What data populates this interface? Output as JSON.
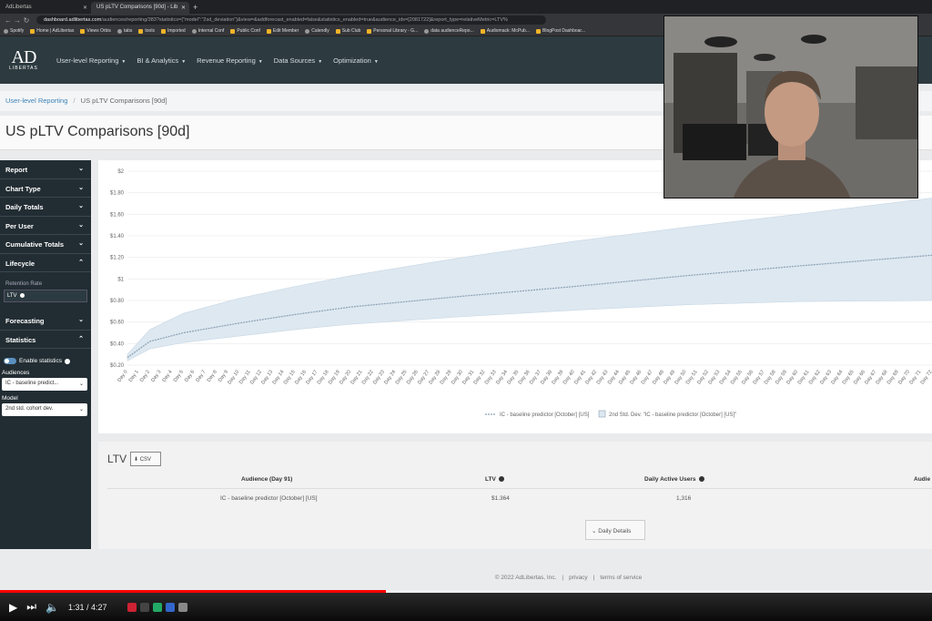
{
  "browser": {
    "tabs": [
      {
        "label": "AdLibertas",
        "active": false
      },
      {
        "label": "US pLTV Comparisons [90d] - Lib",
        "active": true
      }
    ],
    "url_host": "dashboard.adlibertas.com",
    "url_path": "/audiences/reporting/383?statistics={\"model\":\"2sd_deviation\"}&view=&addforecast_enabled=false&statistics_enabled=true&audience_ids=[2081722]&report_type=relativeMetric=LTV%",
    "bookmarks": [
      "Spotify",
      "Home | AdLibertas",
      "Views Orbis",
      "tabs",
      "tools",
      "Imported",
      "Internal Conf",
      "Public Conf",
      "Edit Member",
      "Calendly",
      "Sub Club",
      "Personal Library - G...",
      "data audienceRepo...",
      "Audiomack: McPub...",
      "BlogPost Dashboar..."
    ]
  },
  "app": {
    "logo_text": "AD",
    "logo_sub": "LIBERTAS",
    "nav": [
      "User-level Reporting",
      "BI & Analytics",
      "Revenue Reporting",
      "Data Sources",
      "Optimization"
    ]
  },
  "breadcrumb": {
    "parent": "User-level Reporting",
    "separator": "/",
    "current": "US pLTV Comparisons [90d]"
  },
  "page_title": "US pLTV Comparisons [90d]",
  "sidebar": {
    "sections": [
      "Report",
      "Chart Type",
      "Daily Totals",
      "Per User",
      "Cumulative Totals",
      "Lifecycle"
    ],
    "retention_label": "Retention Rate",
    "ltv_field": "LTV",
    "sections2": [
      "Forecasting",
      "Statistics"
    ],
    "enable_statistics": "Enable statistics",
    "audiences_label": "Audiences",
    "audience_value": "IC - baseline predict...",
    "model_label": "Model",
    "model_value": "2nd std. cohort dev."
  },
  "chart_data": {
    "type": "line",
    "y_ticks": [
      "$2",
      "$1.80",
      "$1.60",
      "$1.40",
      "$1.20",
      "$1",
      "$0.80",
      "$0.60",
      "$0.40",
      "$0.20"
    ],
    "ylim": [
      0.2,
      2
    ],
    "x_tick_prefix": "Day",
    "x_range": [
      0,
      72
    ],
    "series": [
      {
        "name": "IC - baseline predictor [October] [US]",
        "x": [
          0,
          2,
          5,
          10,
          15,
          20,
          30,
          40,
          50,
          60,
          72
        ],
        "values": [
          0.27,
          0.42,
          0.5,
          0.59,
          0.67,
          0.74,
          0.84,
          0.93,
          1.03,
          1.12,
          1.22
        ]
      }
    ],
    "band": {
      "name": "2nd Std. Dev. \"IC - baseline predictor [October] [US]\"",
      "x": [
        0,
        2,
        5,
        10,
        15,
        20,
        30,
        40,
        50,
        60,
        72
      ],
      "upper": [
        0.3,
        0.53,
        0.68,
        0.82,
        0.93,
        1.03,
        1.2,
        1.35,
        1.48,
        1.6,
        1.75
      ],
      "lower": [
        0.24,
        0.35,
        0.41,
        0.47,
        0.53,
        0.58,
        0.65,
        0.71,
        0.76,
        0.79,
        0.8
      ]
    },
    "legend_position": "bottom"
  },
  "ltv_table": {
    "title": "LTV",
    "csv_label": "CSV",
    "headers": [
      "Audience (Day 91)",
      "LTV",
      "Daily Active Users",
      "Audie"
    ],
    "row": [
      "IC - baseline predictor [October] [US]",
      "$1.364",
      "1,316"
    ],
    "daily_details_label": "Daily Details"
  },
  "footer": {
    "copyright": "© 2022 AdLibertas, Inc.",
    "privacy": "privacy",
    "terms": "terms of service"
  },
  "video": {
    "time": "1:31 / 4:27",
    "progress": 0.414
  }
}
